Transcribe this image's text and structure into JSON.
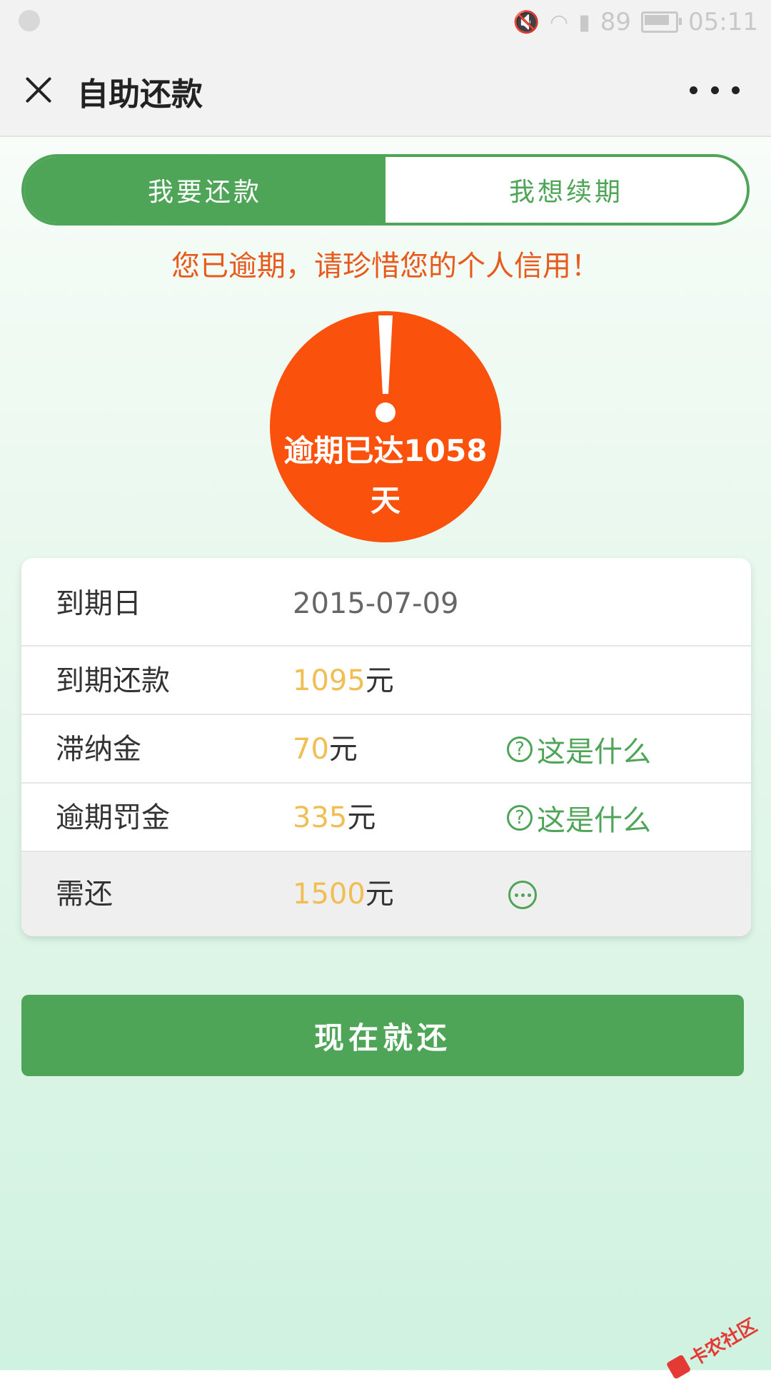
{
  "status_bar": {
    "signal_text": "89",
    "time": "05:11",
    "icons": [
      "mute-icon",
      "wifi-icon",
      "signal-icon",
      "battery-icon"
    ]
  },
  "header": {
    "title": "自助还款"
  },
  "tabs": [
    {
      "label": "我要还款",
      "active": true
    },
    {
      "label": "我想续期",
      "active": false
    }
  ],
  "warning": "您已逾期，请珍惜您的个人信用！",
  "overdue_badge": {
    "line1": "逾期已达1058",
    "line2": "天"
  },
  "details": {
    "due_date": {
      "label": "到期日",
      "value": "2015-07-09"
    },
    "due_amount": {
      "label": "到期还款",
      "value": "1095",
      "unit": "元"
    },
    "late_fee": {
      "label": "滞纳金",
      "value": "70",
      "unit": "元",
      "help": "这是什么"
    },
    "penalty": {
      "label": "逾期罚金",
      "value": "335",
      "unit": "元",
      "help": "这是什么"
    },
    "total": {
      "label": "需还",
      "value": "1500",
      "unit": "元"
    }
  },
  "pay_button": "现在就还",
  "watermark": "卡农社区",
  "colors": {
    "primary_green": "#4ea457",
    "warning_orange": "#fa520d",
    "amount_yellow": "#f0be52"
  }
}
